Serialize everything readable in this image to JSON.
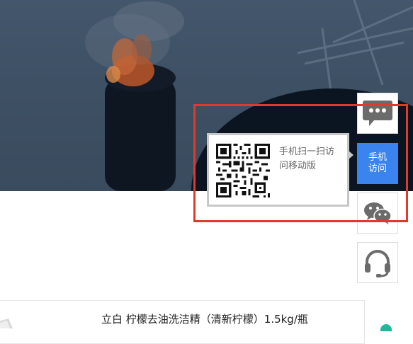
{
  "banner": {
    "description_icon": "chimney-flame-image"
  },
  "product": {
    "title": "立白 柠檬去油洗洁精（清新柠檬）1.5kg/瓶"
  },
  "sidebar": {
    "items": [
      {
        "name": "message",
        "icon": "chat-bubble-icon"
      },
      {
        "name": "mobile",
        "label": "手机\n访问"
      },
      {
        "name": "wechat",
        "icon": "wechat-icon"
      },
      {
        "name": "support",
        "icon": "headset-icon"
      }
    ]
  },
  "qr_popup": {
    "text": "手机扫一扫访问移动版"
  },
  "colors": {
    "accent": "#3b84f0",
    "highlight": "#e03a2a",
    "icon_gray": "#666666"
  }
}
